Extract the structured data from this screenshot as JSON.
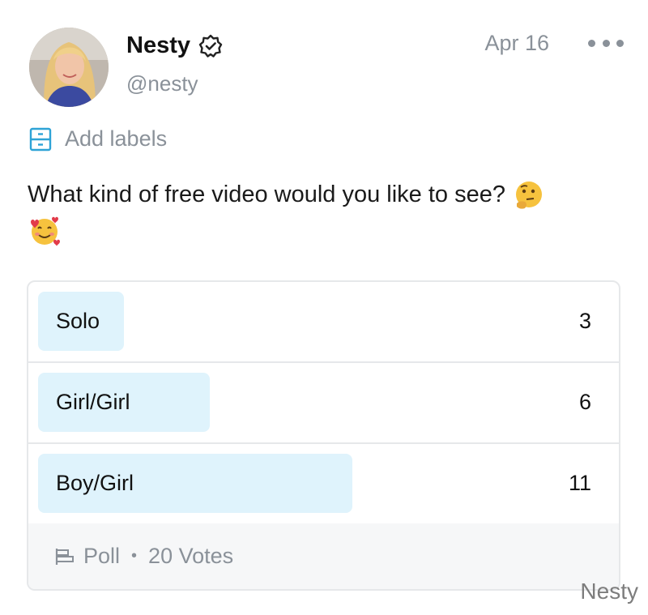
{
  "author": {
    "name": "Nesty",
    "handle": "@nesty",
    "verified": true
  },
  "post": {
    "date": "Apr 16",
    "add_labels": "Add labels",
    "text": "What kind of free video would you like to see?",
    "emojis": [
      "thinking-face",
      "smiling-face-with-hearts"
    ]
  },
  "poll": {
    "options": [
      {
        "label": "Solo",
        "votes": "3",
        "fraction": 0.15
      },
      {
        "label": "Girl/Girl",
        "votes": "6",
        "fraction": 0.3
      },
      {
        "label": "Boy/Girl",
        "votes": "11",
        "fraction": 0.55
      }
    ],
    "footer_label": "Poll",
    "separator": "•",
    "total_votes": "20 Votes"
  },
  "watermark": "Nesty",
  "colors": {
    "accent": "#2ea3d6",
    "poll_fill": "#dff3fc",
    "muted": "#8a9199"
  }
}
